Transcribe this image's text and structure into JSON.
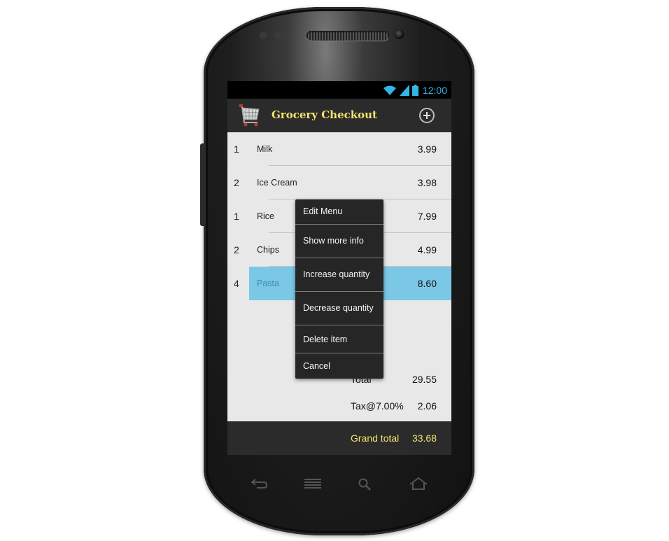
{
  "status": {
    "time": "12:00"
  },
  "app": {
    "title": "Grocery Checkout"
  },
  "items": [
    {
      "qty": "1",
      "name": "Milk",
      "price": "3.99",
      "selected": false
    },
    {
      "qty": "2",
      "name": "Ice Cream",
      "price": "3.98",
      "selected": false
    },
    {
      "qty": "1",
      "name": "Rice",
      "price": "7.99",
      "selected": false
    },
    {
      "qty": "2",
      "name": "Chips",
      "price": "4.99",
      "selected": false
    },
    {
      "qty": "4",
      "name": "Pasta",
      "price": "8.60",
      "selected": true
    }
  ],
  "totals": {
    "total_label": "Total",
    "total_value": "29.55",
    "tax_label": "Tax@7.00%",
    "tax_value": "2.06",
    "grand_label": "Grand total",
    "grand_value": "33.68"
  },
  "context_menu": {
    "title": "Edit Menu",
    "items": [
      "Show more info",
      "Increase quantity",
      "Decrease quantity",
      "Delete item",
      "Cancel"
    ]
  },
  "icons": {
    "wifi": "wifi-icon",
    "signal": "signal-icon",
    "battery": "battery-icon",
    "app": "shopping-cart-icon",
    "add": "add-circle-icon",
    "back": "back-icon",
    "menu": "menu-icon",
    "search": "search-icon",
    "home": "home-icon"
  },
  "colors": {
    "accent_blue": "#33b5e5",
    "title_yellow": "#f2e56f",
    "selection": "#7ac8e6",
    "bar_dark": "#2b2b2b"
  }
}
